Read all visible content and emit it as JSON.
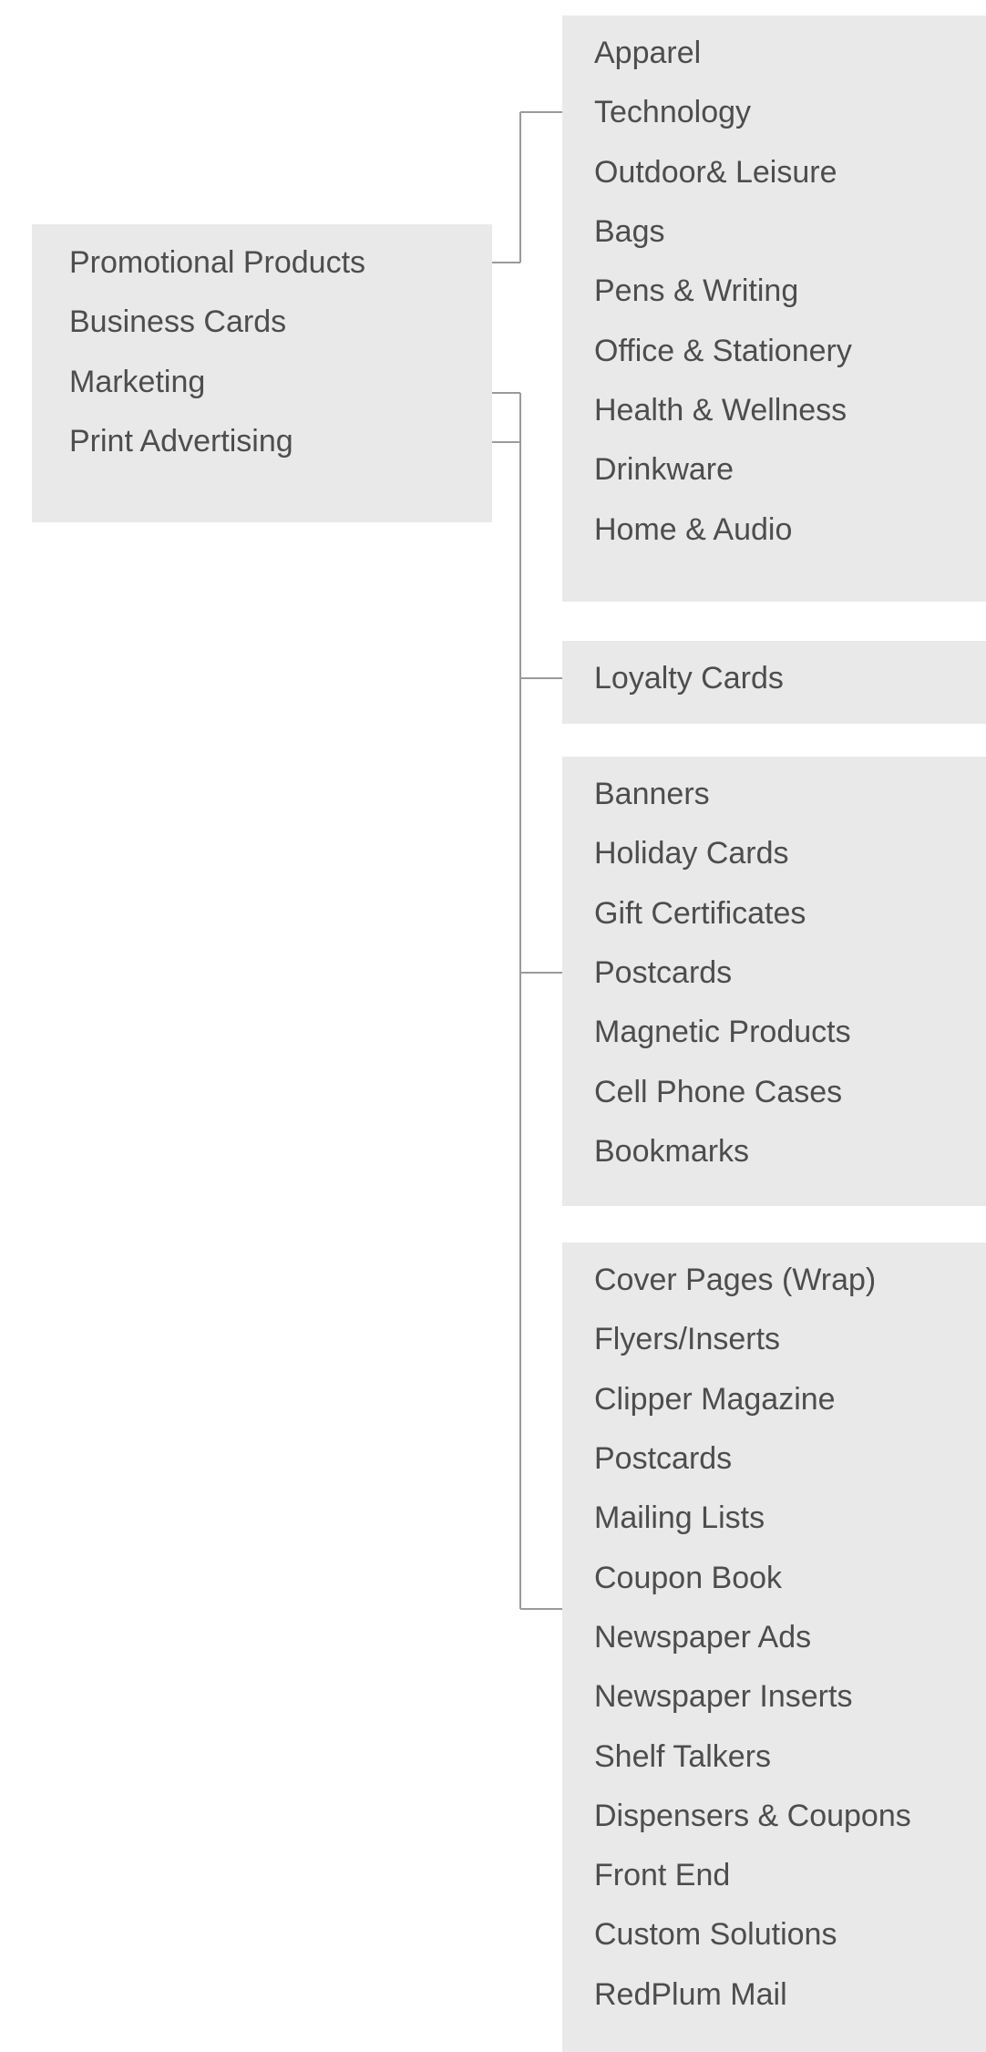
{
  "main_menu": {
    "items": [
      {
        "label": "Promotional Products"
      },
      {
        "label": "Business Cards"
      },
      {
        "label": "Marketing"
      },
      {
        "label": "Print Advertising"
      }
    ]
  },
  "submenus": [
    {
      "parent": "Promotional Products",
      "items": [
        {
          "label": "Apparel"
        },
        {
          "label": "Technology"
        },
        {
          "label": "Outdoor& Leisure"
        },
        {
          "label": "Bags"
        },
        {
          "label": "Pens & Writing"
        },
        {
          "label": "Office & Stationery"
        },
        {
          "label": "Health & Wellness"
        },
        {
          "label": "Drinkware"
        },
        {
          "label": "Home & Audio"
        }
      ]
    },
    {
      "parent": "Business Cards",
      "items": [
        {
          "label": "Loyalty Cards"
        }
      ]
    },
    {
      "parent": "Marketing",
      "items": [
        {
          "label": "Banners"
        },
        {
          "label": "Holiday Cards"
        },
        {
          "label": "Gift Certificates"
        },
        {
          "label": "Postcards"
        },
        {
          "label": "Magnetic Products"
        },
        {
          "label": "Cell Phone Cases"
        },
        {
          "label": "Bookmarks"
        }
      ]
    },
    {
      "parent": "Print Advertising",
      "items": [
        {
          "label": "Cover Pages (Wrap)"
        },
        {
          "label": "Flyers/Inserts"
        },
        {
          "label": "Clipper Magazine"
        },
        {
          "label": "Postcards"
        },
        {
          "label": "Mailing Lists"
        },
        {
          "label": "Coupon Book"
        },
        {
          "label": "Newspaper Ads"
        },
        {
          "label": "Newspaper Inserts"
        },
        {
          "label": "Shelf Talkers"
        },
        {
          "label": "Dispensers & Coupons"
        },
        {
          "label": "Front End"
        },
        {
          "label": "Custom Solutions"
        },
        {
          "label": "RedPlum Mail"
        }
      ]
    }
  ],
  "colors": {
    "panel_background": "#e9e9e9",
    "text": "#4d4d4d",
    "connector": "#9a9a9a"
  }
}
